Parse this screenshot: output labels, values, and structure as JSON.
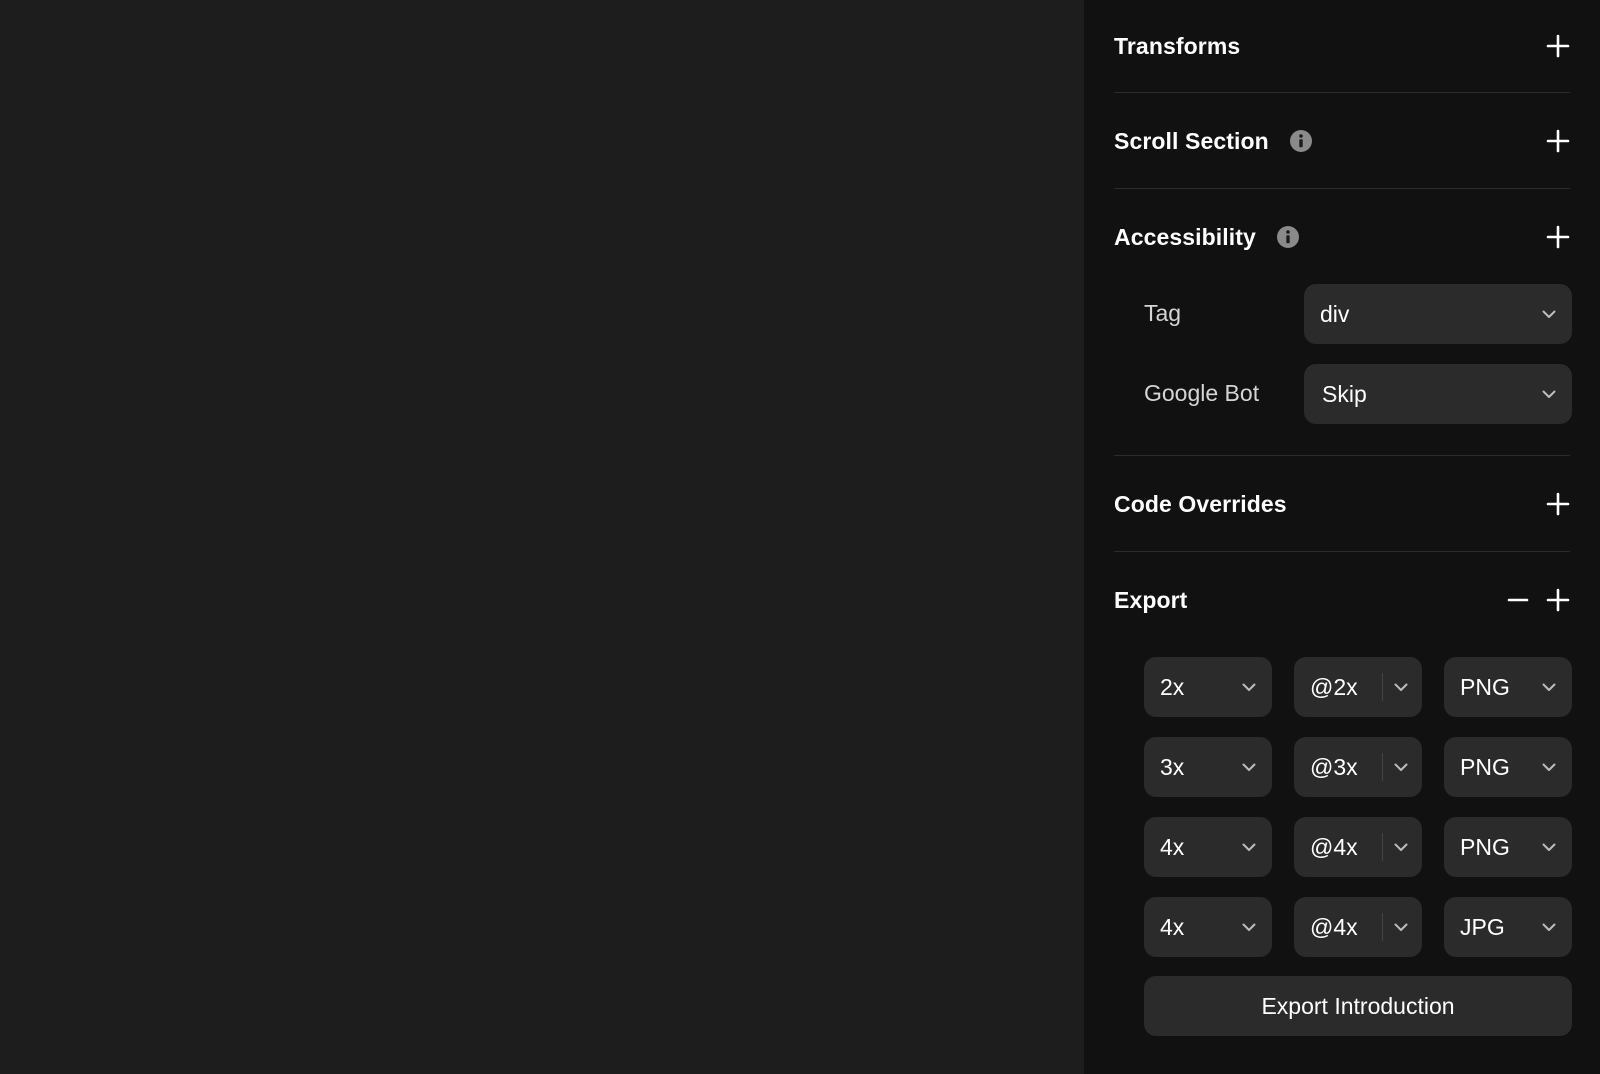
{
  "sections": {
    "transforms": {
      "title": "Transforms"
    },
    "scroll_section": {
      "title": "Scroll Section"
    },
    "accessibility": {
      "title": "Accessibility",
      "tag_label": "Tag",
      "tag_value": "div",
      "googlebot_label": "Google Bot",
      "googlebot_value": "Skip"
    },
    "code_overrides": {
      "title": "Code Overrides"
    },
    "export": {
      "title": "Export",
      "rows": [
        {
          "scale": "2x",
          "suffix": "@2x",
          "format": "PNG"
        },
        {
          "scale": "3x",
          "suffix": "@3x",
          "format": "PNG"
        },
        {
          "scale": "4x",
          "suffix": "@4x",
          "format": "PNG"
        },
        {
          "scale": "4x",
          "suffix": "@4x",
          "format": "JPG"
        }
      ],
      "button_label": "Export Introduction"
    }
  },
  "icons": {
    "add": "plus-icon",
    "remove": "minus-icon",
    "info": "info-icon",
    "dropdown": "chevron-down-icon"
  },
  "colors": {
    "canvas_bg": "#1d1d1d",
    "panel_bg": "#111111",
    "control_bg": "#2b2b2b",
    "divider": "#2c2c2c",
    "text": "#ffffff",
    "muted_text": "#d5d5d5"
  }
}
